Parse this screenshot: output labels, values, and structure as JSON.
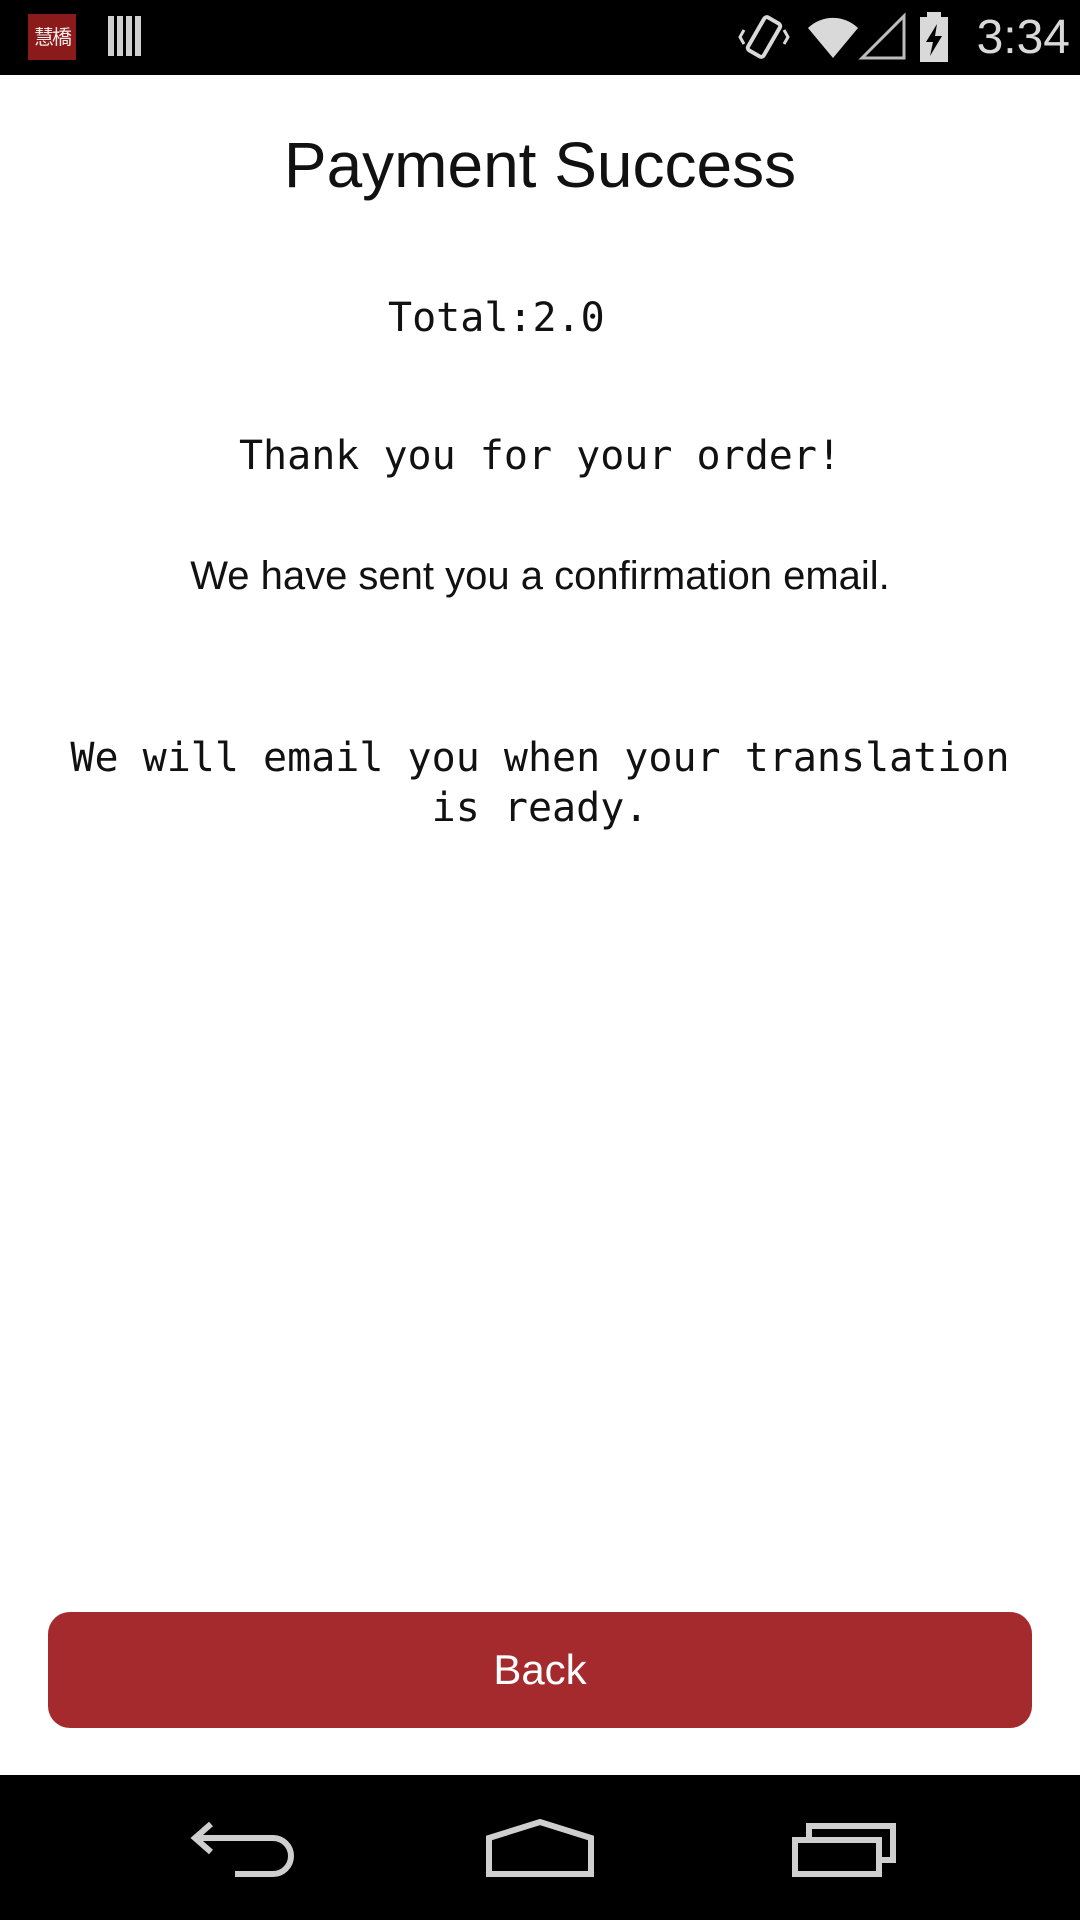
{
  "status_bar": {
    "time": "3:34",
    "app_logo_text": "慧橋",
    "icons": [
      "app-logo-icon",
      "notification-icon",
      "vibrate-icon",
      "wifi-icon",
      "cell-signal-icon",
      "battery-charging-icon"
    ]
  },
  "page": {
    "title": "Payment Success",
    "total": "Total:2.0",
    "thank_you": "Thank you for your order!",
    "confirmation": "We have sent you a confirmation email.",
    "translation_note": "We will email you when your translation is ready."
  },
  "actions": {
    "back_label": "Back"
  },
  "nav_bar": {
    "icons": [
      "back-icon",
      "home-icon",
      "recents-icon"
    ]
  },
  "colors": {
    "accent": "#a52a2d",
    "status_bar_bg": "#000000",
    "nav_bar_bg": "#000000",
    "text": "#111111",
    "background": "#ffffff"
  }
}
